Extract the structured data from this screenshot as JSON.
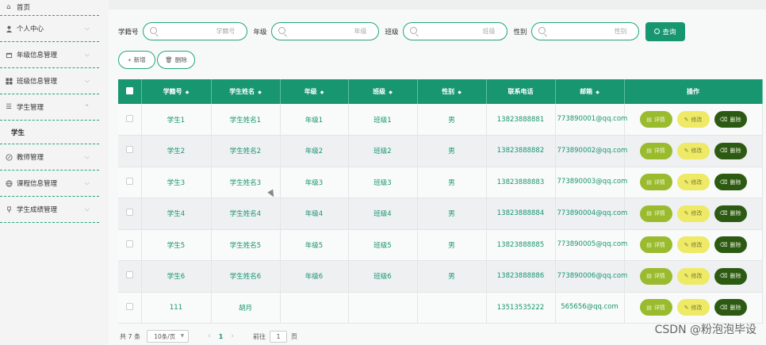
{
  "sidebar": {
    "items": [
      {
        "label": "首页",
        "icon": "home-icon"
      },
      {
        "label": "个人中心",
        "icon": "user-icon"
      },
      {
        "label": "年级信息管理",
        "icon": "calendar-icon"
      },
      {
        "label": "班级信息管理",
        "icon": "grid-icon"
      },
      {
        "label": "学生管理",
        "icon": "list-icon",
        "expanded": true,
        "children": [
          "学生"
        ]
      },
      {
        "label": "教师管理",
        "icon": "compass-icon"
      },
      {
        "label": "课程信息管理",
        "icon": "globe-icon"
      },
      {
        "label": "学生成绩管理",
        "icon": "trophy-icon"
      }
    ]
  },
  "search": {
    "fields": [
      {
        "label": "学籍号",
        "placeholder": "学籍号"
      },
      {
        "label": "年级",
        "placeholder": "年级"
      },
      {
        "label": "班级",
        "placeholder": "班级"
      },
      {
        "label": "性别",
        "placeholder": "性别"
      }
    ],
    "query_label": "查询"
  },
  "actions": {
    "add_label": "新增",
    "delete_label": "删除"
  },
  "table": {
    "headers": [
      "学籍号",
      "学生姓名",
      "年级",
      "班级",
      "性别",
      "联系电话",
      "邮箱",
      "操作"
    ],
    "rows": [
      [
        "学生1",
        "学生姓名1",
        "年级1",
        "班级1",
        "男",
        "13823888881",
        "773890001@qq.com"
      ],
      [
        "学生2",
        "学生姓名2",
        "年级2",
        "班级2",
        "男",
        "13823888882",
        "773890002@qq.com"
      ],
      [
        "学生3",
        "学生姓名3",
        "年级3",
        "班级3",
        "男",
        "13823888883",
        "773890003@qq.com"
      ],
      [
        "学生4",
        "学生姓名4",
        "年级4",
        "班级4",
        "男",
        "13823888884",
        "773890004@qq.com"
      ],
      [
        "学生5",
        "学生姓名5",
        "年级5",
        "班级5",
        "男",
        "13823888885",
        "773890005@qq.com"
      ],
      [
        "学生6",
        "学生姓名6",
        "年级6",
        "班级6",
        "男",
        "13823888886",
        "773890006@qq.com"
      ],
      [
        "111",
        "胡月",
        "",
        "",
        "",
        "13513535222",
        "565656@qq.com"
      ]
    ],
    "row_ops": {
      "detail": "详情",
      "edit": "修改",
      "delete": "删除"
    }
  },
  "pager": {
    "total": "共 7 条",
    "page_size": "10条/页",
    "current_page": "1",
    "goto_prefix": "前往",
    "goto_value": "1",
    "goto_suffix": "页"
  },
  "watermark": "CSDN @粉泡泡毕设",
  "colors": {
    "primary": "#17966f",
    "detail": "#9bbb2f",
    "edit": "#eeea66",
    "delete": "#2d5a12"
  }
}
